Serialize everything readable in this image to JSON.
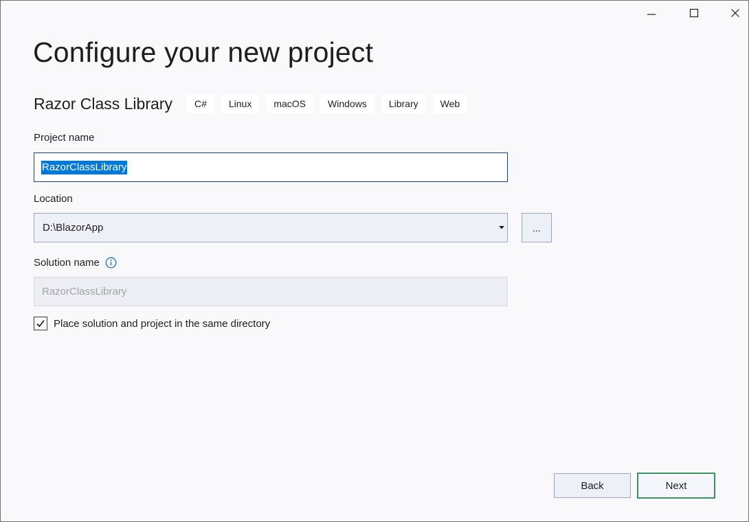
{
  "window": {
    "controls": {
      "minimize_icon": "minimize-icon",
      "maximize_icon": "maximize-icon",
      "close_icon": "close-icon"
    }
  },
  "header": {
    "title": "Configure your new project",
    "template_name": "Razor Class Library",
    "tags": [
      "C#",
      "Linux",
      "macOS",
      "Windows",
      "Library",
      "Web"
    ]
  },
  "form": {
    "project_name": {
      "label": "Project name",
      "value": "RazorClassLibrary"
    },
    "location": {
      "label": "Location",
      "value": "D:\\BlazorApp",
      "browse_label": "..."
    },
    "solution_name": {
      "label": "Solution name",
      "value": "RazorClassLibrary",
      "info_icon": "info-icon"
    },
    "same_directory": {
      "label": "Place solution and project in the same directory",
      "checked": true
    }
  },
  "footer": {
    "back_label": "Back",
    "next_label": "Next"
  },
  "colors": {
    "accent": "#0078d7",
    "next_border": "#3b8f63",
    "info": "#1a73c7"
  }
}
